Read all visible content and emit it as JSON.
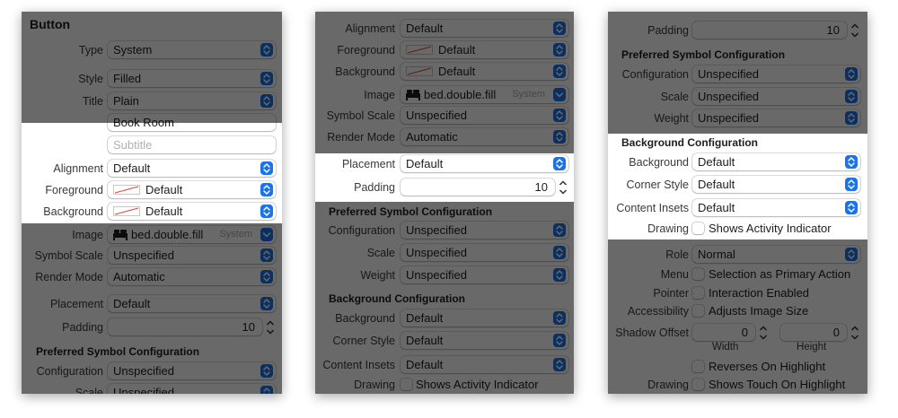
{
  "colors": {
    "accent": "#1a73e8",
    "dim_overlay": "rgba(0,0,0,0.59)"
  },
  "panel1": {
    "title": "Button",
    "type_label": "Type",
    "type_value": "System",
    "style_label": "Style",
    "style_value": "Filled",
    "title_label": "Title",
    "title_value": "Plain",
    "title_text": "Book Room",
    "subtitle_placeholder": "Subtitle",
    "alignment_label": "Alignment",
    "alignment_value": "Default",
    "foreground_label": "Foreground",
    "foreground_value": "Default",
    "background_label": "Background",
    "background_value": "Default",
    "image_label": "Image",
    "image_value": "bed.double.fill",
    "image_system": "System",
    "symbol_scale_label": "Symbol Scale",
    "symbol_scale_value": "Unspecified",
    "render_mode_label": "Render Mode",
    "render_mode_value": "Automatic",
    "placement_label": "Placement",
    "placement_value": "Default",
    "padding_label": "Padding",
    "padding_value": "10",
    "psc_header": "Preferred Symbol Configuration",
    "configuration_label": "Configuration",
    "configuration_value": "Unspecified",
    "scale_label": "Scale",
    "scale_value": "Unspecified"
  },
  "panel2": {
    "alignment_label": "Alignment",
    "alignment_value": "Default",
    "foreground_label": "Foreground",
    "foreground_value": "Default",
    "background_label": "Background",
    "background_value": "Default",
    "image_label": "Image",
    "image_value": "bed.double.fill",
    "image_system": "System",
    "symbol_scale_label": "Symbol Scale",
    "symbol_scale_value": "Unspecified",
    "render_mode_label": "Render Mode",
    "render_mode_value": "Automatic",
    "placement_label": "Placement",
    "placement_value": "Default",
    "padding_label": "Padding",
    "padding_value": "10",
    "psc_header": "Preferred Symbol Configuration",
    "configuration_label": "Configuration",
    "configuration_value": "Unspecified",
    "scale_label": "Scale",
    "scale_value": "Unspecified",
    "weight_label": "Weight",
    "weight_value": "Unspecified",
    "bg_header": "Background Configuration",
    "bg_background_label": "Background",
    "bg_background_value": "Default",
    "corner_style_label": "Corner Style",
    "corner_style_value": "Default",
    "content_insets_label": "Content Insets",
    "content_insets_value": "Default",
    "drawing_label": "Drawing",
    "drawing_option": "Shows Activity Indicator"
  },
  "panel3": {
    "padding_label": "Padding",
    "padding_value": "10",
    "psc_header": "Preferred Symbol Configuration",
    "configuration_label": "Configuration",
    "configuration_value": "Unspecified",
    "scale_label": "Scale",
    "scale_value": "Unspecified",
    "weight_label": "Weight",
    "weight_value": "Unspecified",
    "bg_header": "Background Configuration",
    "bg_background_label": "Background",
    "bg_background_value": "Default",
    "corner_style_label": "Corner Style",
    "corner_style_value": "Default",
    "content_insets_label": "Content Insets",
    "content_insets_value": "Default",
    "drawing_label": "Drawing",
    "drawing_option": "Shows Activity Indicator",
    "role_label": "Role",
    "role_value": "Normal",
    "menu_label": "Menu",
    "menu_option": "Selection as Primary Action",
    "pointer_label": "Pointer",
    "pointer_option": "Interaction Enabled",
    "accessibility_label": "Accessibility",
    "accessibility_option": "Adjusts Image Size",
    "shadow_offset_label": "Shadow Offset",
    "shadow_width_value": "0",
    "shadow_height_value": "0",
    "width_label": "Width",
    "height_label": "Height",
    "reverses_option": "Reverses On Highlight",
    "drawing2_label": "Drawing",
    "touch_option": "Shows Touch On Highlight"
  }
}
